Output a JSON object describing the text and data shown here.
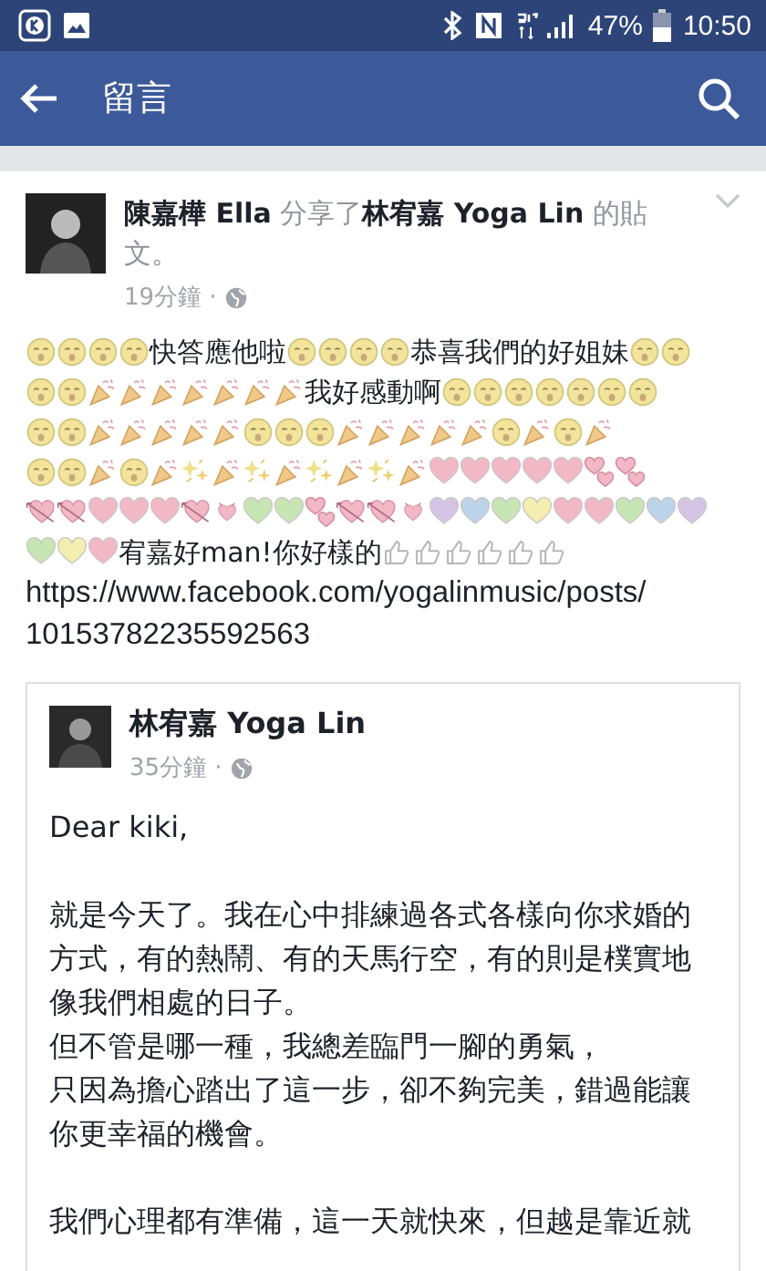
{
  "status_bar": {
    "battery": "47%",
    "time": "10:50"
  },
  "app_bar": {
    "title": "留言"
  },
  "post": {
    "headline": "**陳嘉樺 Ella** 分享了**林宥嘉 Yoga Lin** 的貼文。",
    "time": "19分鐘 ·",
    "lines": [
      [
        {
          "kind": "face"
        },
        {
          "kind": "face"
        },
        {
          "kind": "face"
        },
        {
          "kind": "face"
        },
        {
          "kind": "text",
          "text": "快答應他啦"
        },
        {
          "kind": "face"
        },
        {
          "kind": "face"
        },
        {
          "kind": "face"
        },
        {
          "kind": "face"
        },
        {
          "kind": "text",
          "text": "恭喜我們的好姐妹"
        },
        {
          "kind": "face"
        },
        {
          "kind": "face"
        }
      ],
      [
        {
          "kind": "face"
        },
        {
          "kind": "face"
        },
        {
          "kind": "party"
        },
        {
          "kind": "party"
        },
        {
          "kind": "party"
        },
        {
          "kind": "party"
        },
        {
          "kind": "party"
        },
        {
          "kind": "party"
        },
        {
          "kind": "party"
        },
        {
          "kind": "text",
          "text": "我好感動啊"
        },
        {
          "kind": "face"
        },
        {
          "kind": "face"
        },
        {
          "kind": "face"
        },
        {
          "kind": "face"
        },
        {
          "kind": "face"
        },
        {
          "kind": "face"
        },
        {
          "kind": "face"
        }
      ],
      [
        {
          "kind": "face"
        },
        {
          "kind": "face"
        },
        {
          "kind": "party"
        },
        {
          "kind": "party"
        },
        {
          "kind": "party"
        },
        {
          "kind": "party"
        },
        {
          "kind": "party"
        },
        {
          "kind": "face"
        },
        {
          "kind": "face"
        },
        {
          "kind": "face"
        },
        {
          "kind": "party"
        },
        {
          "kind": "party"
        },
        {
          "kind": "party"
        },
        {
          "kind": "party"
        },
        {
          "kind": "party"
        },
        {
          "kind": "face"
        },
        {
          "kind": "party"
        },
        {
          "kind": "face"
        },
        {
          "kind": "party"
        }
      ],
      [
        {
          "kind": "face"
        },
        {
          "kind": "face"
        },
        {
          "kind": "party"
        },
        {
          "kind": "face"
        },
        {
          "kind": "party"
        },
        {
          "kind": "sparkle"
        },
        {
          "kind": "party"
        },
        {
          "kind": "sparkle"
        },
        {
          "kind": "party"
        },
        {
          "kind": "sparkle"
        },
        {
          "kind": "party"
        },
        {
          "kind": "sparkle"
        },
        {
          "kind": "party"
        },
        {
          "kind": "heart",
          "color": "#f2b8c6"
        },
        {
          "kind": "heart",
          "color": "#f2b8c6"
        },
        {
          "kind": "heart",
          "color": "#f2b8c6"
        },
        {
          "kind": "heart",
          "color": "#f2b8c6"
        },
        {
          "kind": "heart",
          "color": "#f2b8c6"
        },
        {
          "kind": "two-hearts"
        },
        {
          "kind": "two-hearts"
        }
      ],
      [
        {
          "kind": "heart-arrow"
        },
        {
          "kind": "heart-arrow"
        },
        {
          "kind": "heart",
          "color": "#f2b8c6"
        },
        {
          "kind": "heart",
          "color": "#f2b8c6"
        },
        {
          "kind": "heart",
          "color": "#f2b8c6"
        },
        {
          "kind": "heart-arrow"
        },
        {
          "kind": "small-heart"
        },
        {
          "kind": "heart",
          "color": "#c8e6b4"
        },
        {
          "kind": "heart",
          "color": "#c8e6b4"
        },
        {
          "kind": "two-hearts"
        },
        {
          "kind": "heart-arrow"
        },
        {
          "kind": "heart-arrow"
        },
        {
          "kind": "small-heart"
        },
        {
          "kind": "heart",
          "color": "#d6c4e4"
        },
        {
          "kind": "heart",
          "color": "#bcd4ea"
        },
        {
          "kind": "heart",
          "color": "#c8e6b4"
        },
        {
          "kind": "heart",
          "color": "#f4eeb0"
        },
        {
          "kind": "heart",
          "color": "#f2b8c6"
        },
        {
          "kind": "heart",
          "color": "#f2b8c6"
        },
        {
          "kind": "heart",
          "color": "#c8e6b4"
        },
        {
          "kind": "heart",
          "color": "#bcd4ea"
        },
        {
          "kind": "heart",
          "color": "#d6c4e4"
        }
      ],
      [
        {
          "kind": "heart",
          "color": "#c8e6b4"
        },
        {
          "kind": "heart",
          "color": "#f4eeb0"
        },
        {
          "kind": "heart",
          "color": "#f2b8c6"
        },
        {
          "kind": "text",
          "text": "宥嘉好man!你好樣的"
        },
        {
          "kind": "thumb"
        },
        {
          "kind": "thumb"
        },
        {
          "kind": "thumb"
        },
        {
          "kind": "thumb"
        },
        {
          "kind": "thumb"
        },
        {
          "kind": "thumb"
        }
      ]
    ],
    "link": "https://www.facebook.com/yogalinmusic/posts/10153782235592563",
    "shared": {
      "author": "林宥嘉 Yoga Lin",
      "time": "35分鐘 ·",
      "paragraphs": [
        [
          "Dear kiki,"
        ],
        [
          "就是今天了。我在心中排練過各式各樣向你求婚的方式，有的熱鬧、有的天馬行空，有的則是樸實地像我們相處的日子。",
          "但不管是哪一種，我總差臨門一腳的勇氣，",
          "只因為擔心踏出了這一步，卻不夠完美，錯過能讓你更幸福的機會。"
        ],
        [
          "我們心理都有準備，這一天就快來，但越是靠近就"
        ]
      ]
    }
  }
}
